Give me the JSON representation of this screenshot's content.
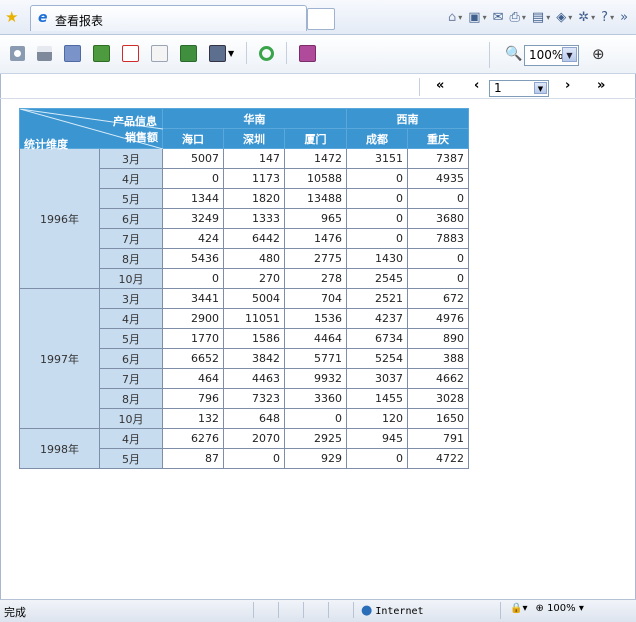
{
  "tab": {
    "title": "查看报表"
  },
  "toolbar": {
    "zoom_value": "100%"
  },
  "pager": {
    "first": "«",
    "prev": "‹",
    "page_value": "1",
    "next": "›",
    "last": "»"
  },
  "report": {
    "corner": {
      "top": "产品信息",
      "middle": "销售额",
      "left": "统计维度"
    },
    "regions": [
      {
        "name": "华南",
        "cities": [
          "海口",
          "深圳",
          "厦门"
        ]
      },
      {
        "name": "西南",
        "cities": [
          "成都",
          "重庆"
        ]
      }
    ],
    "years": [
      {
        "year": "1996年",
        "rows": [
          {
            "month": "3月",
            "values": [
              "5007",
              "147",
              "1472",
              "3151",
              "7387"
            ]
          },
          {
            "month": "4月",
            "values": [
              "0",
              "1173",
              "10588",
              "0",
              "4935"
            ]
          },
          {
            "month": "5月",
            "values": [
              "1344",
              "1820",
              "13488",
              "0",
              "0"
            ]
          },
          {
            "month": "6月",
            "values": [
              "3249",
              "1333",
              "965",
              "0",
              "3680"
            ]
          },
          {
            "month": "7月",
            "values": [
              "424",
              "6442",
              "1476",
              "0",
              "7883"
            ]
          },
          {
            "month": "8月",
            "values": [
              "5436",
              "480",
              "2775",
              "1430",
              "0"
            ]
          },
          {
            "month": "10月",
            "values": [
              "0",
              "270",
              "278",
              "2545",
              "0"
            ]
          }
        ]
      },
      {
        "year": "1997年",
        "rows": [
          {
            "month": "3月",
            "values": [
              "3441",
              "5004",
              "704",
              "2521",
              "672"
            ]
          },
          {
            "month": "4月",
            "values": [
              "2900",
              "11051",
              "1536",
              "4237",
              "4976"
            ]
          },
          {
            "month": "5月",
            "values": [
              "1770",
              "1586",
              "4464",
              "6734",
              "890"
            ]
          },
          {
            "month": "6月",
            "values": [
              "6652",
              "3842",
              "5771",
              "5254",
              "388"
            ]
          },
          {
            "month": "7月",
            "values": [
              "464",
              "4463",
              "9932",
              "3037",
              "4662"
            ]
          },
          {
            "month": "8月",
            "values": [
              "796",
              "7323",
              "3360",
              "1455",
              "3028"
            ]
          },
          {
            "month": "10月",
            "values": [
              "132",
              "648",
              "0",
              "120",
              "1650"
            ]
          }
        ]
      },
      {
        "year": "1998年",
        "rows": [
          {
            "month": "4月",
            "values": [
              "6276",
              "2070",
              "2925",
              "945",
              "791"
            ]
          },
          {
            "month": "5月",
            "values": [
              "87",
              "0",
              "929",
              "0",
              "4722"
            ]
          }
        ]
      }
    ]
  },
  "status": {
    "text": "完成",
    "zone": "Internet",
    "zoom": "100%"
  },
  "colors": {
    "header": "#3b95d1",
    "row_header": "#c8dcef",
    "accent": "#1d6fd6"
  }
}
